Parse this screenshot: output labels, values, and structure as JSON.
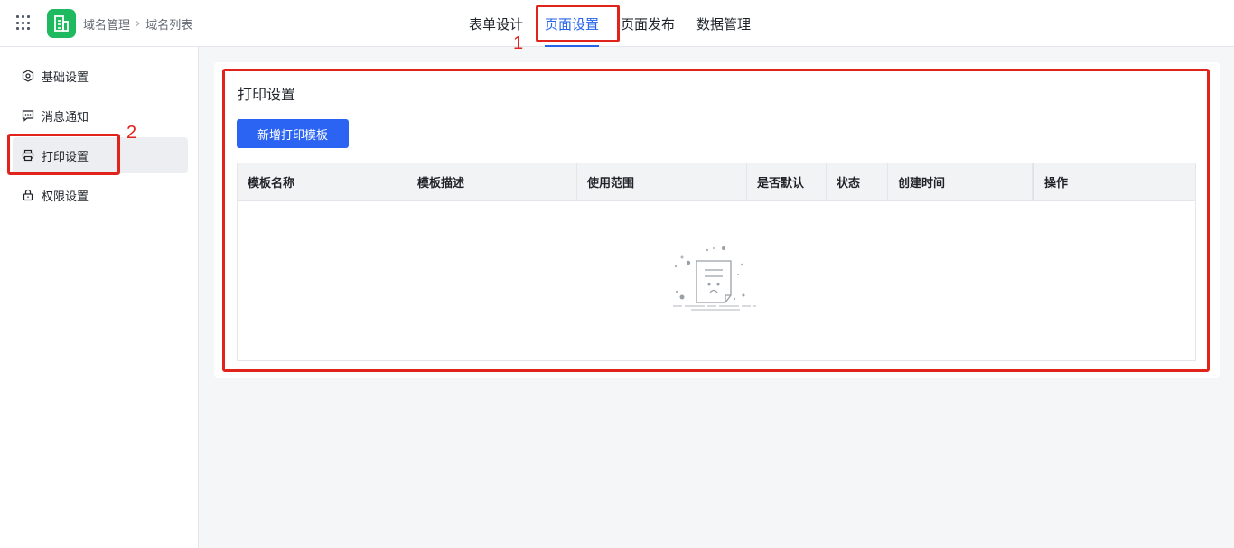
{
  "header": {
    "breadcrumb": [
      "域名管理",
      "域名列表"
    ],
    "tabs": [
      {
        "label": "表单设计",
        "active": false
      },
      {
        "label": "页面设置",
        "active": true
      },
      {
        "label": "页面发布",
        "active": false
      },
      {
        "label": "数据管理",
        "active": false
      }
    ]
  },
  "sidebar": {
    "items": [
      {
        "label": "基础设置",
        "icon": "settings-icon",
        "active": false
      },
      {
        "label": "消息通知",
        "icon": "message-icon",
        "active": false
      },
      {
        "label": "打印设置",
        "icon": "printer-icon",
        "active": true
      },
      {
        "label": "权限设置",
        "icon": "lock-icon",
        "active": false
      }
    ]
  },
  "main": {
    "title": "打印设置",
    "add_button": "新增打印模板",
    "table": {
      "columns": [
        "模板名称",
        "模板描述",
        "使用范围",
        "是否默认",
        "状态",
        "创建时间",
        "操作"
      ],
      "rows": []
    }
  },
  "annotations": [
    "1",
    "2"
  ],
  "colors": {
    "accent": "#2563eb",
    "button": "#2b63f3",
    "logo": "#1fb95f",
    "annotation": "#e0241b"
  }
}
